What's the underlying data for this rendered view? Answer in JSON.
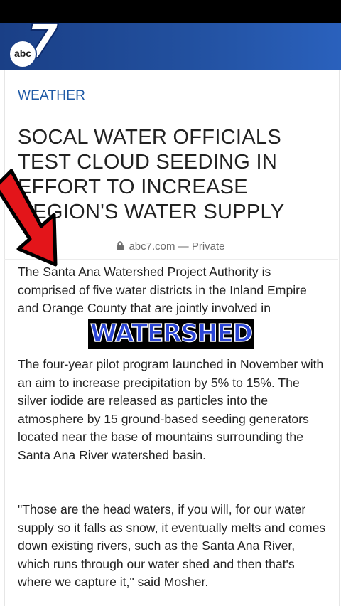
{
  "brand": {
    "logo_number": "7",
    "logo_abc": "abc"
  },
  "article": {
    "category": "WEATHER",
    "headline": "SOCAL WATER OFFICIALS TEST CLOUD SEEDING IN EFFORT TO INCREASE REGION'S WATER SUPPLY",
    "source_domain": "abc7.com",
    "source_separator": "—",
    "source_privacy": "Private",
    "paragraphs": [
      "The Santa Ana Watershed Project Authority is comprised of five water districts in the Inland Empire and Orange County that are jointly involved in",
      "The four-year pilot program launched in November with an aim to increase precipitation by 5% to 15%. The silver iodide are released as particles into the atmosphere by 15 ground-based seeding generators located near the base of mountains surrounding the Santa Ana River watershed basin.",
      "\"Those are the head waters, if you will, for our water supply so it falls as snow, it eventually melts and comes down existing rivers, such as the Santa Ana River, which runs through our water shed and then that's where we capture it,\" said Mosher."
    ]
  },
  "overlay": {
    "caption": "WATERSHED"
  },
  "colors": {
    "header_blue": "#22509f",
    "category_blue": "#1f5aa6",
    "arrow_red": "#e3151a",
    "caption_blue": "#2b45d6"
  },
  "icons": {
    "lock": "lock-icon",
    "arrow": "red-arrow-icon"
  }
}
